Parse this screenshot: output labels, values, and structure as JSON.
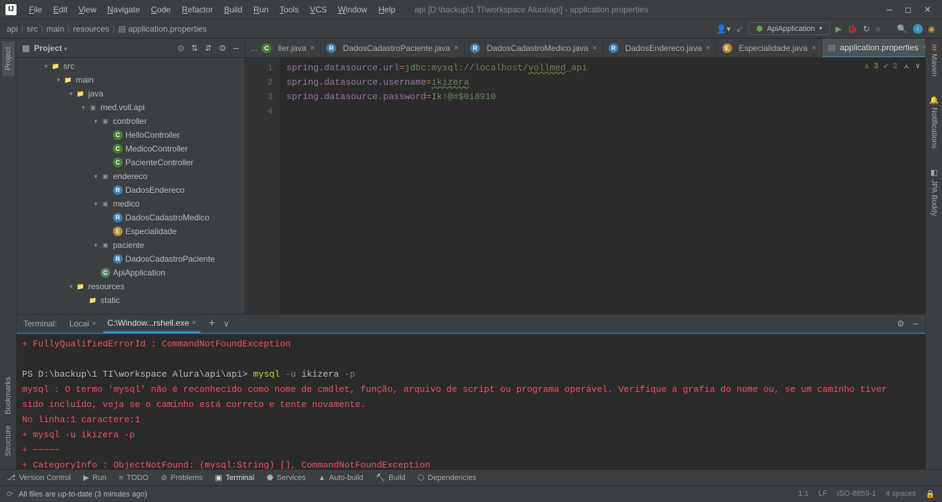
{
  "titlebar": {
    "title": "api [D:\\backup\\1 TI\\workspace Alura\\api] - application.properties",
    "menu": [
      "File",
      "Edit",
      "View",
      "Navigate",
      "Code",
      "Refactor",
      "Build",
      "Run",
      "Tools",
      "VCS",
      "Window",
      "Help"
    ]
  },
  "breadcrumb": [
    "api",
    "src",
    "main",
    "resources",
    "application.properties"
  ],
  "run_config": "ApiApplication",
  "project_panel": {
    "title": "Project",
    "tree": [
      {
        "depth": 2,
        "arrow": "▾",
        "icon": "folder",
        "label": "src"
      },
      {
        "depth": 3,
        "arrow": "▾",
        "icon": "folder-blue",
        "label": "main"
      },
      {
        "depth": 4,
        "arrow": "▾",
        "icon": "folder-blue",
        "label": "java"
      },
      {
        "depth": 5,
        "arrow": "▾",
        "icon": "pkg",
        "label": "med.voll.api"
      },
      {
        "depth": 6,
        "arrow": "▾",
        "icon": "pkg",
        "label": "controller"
      },
      {
        "depth": 7,
        "arrow": "",
        "icon": "C",
        "label": "HelloController"
      },
      {
        "depth": 7,
        "arrow": "",
        "icon": "C",
        "label": "MedicoController"
      },
      {
        "depth": 7,
        "arrow": "",
        "icon": "C",
        "label": "PacienteController"
      },
      {
        "depth": 6,
        "arrow": "▾",
        "icon": "pkg",
        "label": "endereco"
      },
      {
        "depth": 7,
        "arrow": "",
        "icon": "R",
        "label": "DadosEndereco"
      },
      {
        "depth": 6,
        "arrow": "▾",
        "icon": "pkg",
        "label": "medico"
      },
      {
        "depth": 7,
        "arrow": "",
        "icon": "R",
        "label": "DadosCadastroMedico"
      },
      {
        "depth": 7,
        "arrow": "",
        "icon": "E",
        "label": "Especialidade"
      },
      {
        "depth": 6,
        "arrow": "▾",
        "icon": "pkg",
        "label": "paciente"
      },
      {
        "depth": 7,
        "arrow": "",
        "icon": "R",
        "label": "DadosCadastroPaciente"
      },
      {
        "depth": 6,
        "arrow": "",
        "icon": "S",
        "label": "ApiApplication"
      },
      {
        "depth": 4,
        "arrow": "▾",
        "icon": "folder-res",
        "label": "resources"
      },
      {
        "depth": 5,
        "arrow": "",
        "icon": "folder",
        "label": "static"
      }
    ]
  },
  "editor_tabs": [
    {
      "label": "ller.java",
      "icon": "C",
      "active": false,
      "trunc": true
    },
    {
      "label": "DadosCadastroPaciente.java",
      "icon": "R",
      "active": false
    },
    {
      "label": "DadosCadastroMedico.java",
      "icon": "R",
      "active": false
    },
    {
      "label": "DadosEndereco.java",
      "icon": "R",
      "active": false
    },
    {
      "label": "Especialidade.java",
      "icon": "E",
      "active": false
    },
    {
      "label": "application.properties",
      "icon": "props",
      "active": true
    }
  ],
  "editor": {
    "warnings": "3",
    "ok": "2",
    "lines": [
      {
        "n": "1",
        "key": "spring.datasource.url",
        "val": "jdbc:mysql://localhost/",
        "val_u": "vollmed",
        "val2": "_api"
      },
      {
        "n": "2",
        "key": "spring.datasource.username",
        "val": "",
        "val_u": "ikizera",
        "val2": ""
      },
      {
        "n": "3",
        "key": "spring.datasource.password",
        "val": "Ik!@#$0i8910",
        "val_u": "",
        "val2": ""
      },
      {
        "n": "4",
        "key": "",
        "val": "",
        "val_u": "",
        "val2": ""
      }
    ]
  },
  "terminal": {
    "label": "Terminal:",
    "tabs": [
      {
        "label": "Local",
        "active": false
      },
      {
        "label": "C:\\Window...rshell.exe",
        "active": true
      }
    ],
    "lines": [
      {
        "cls": "red",
        "indent": "    ",
        "text": "+ FullyQualifiedErrorId : CommandNotFoundException"
      },
      {
        "cls": "",
        "text": ""
      },
      {
        "cls": "prompt",
        "prefix": "PS D:\\backup\\1 TI\\workspace Alura\\api\\api> ",
        "cmd": "mysql",
        "arg1": " -u ",
        "arg2": "ikizera",
        "arg3": " -p"
      },
      {
        "cls": "red",
        "text": "mysql : O termo 'mysql' não é reconhecido como nome de cmdlet, função, arquivo de script ou programa operável. Verifique a grafia do nome ou, se um caminho tiver"
      },
      {
        "cls": "red",
        "text": "sido incluído, veja se o caminho está correto e tente novamente."
      },
      {
        "cls": "red",
        "text": "No linha:1 caractere:1"
      },
      {
        "cls": "red",
        "text": "+ mysql -u ikizera -p"
      },
      {
        "cls": "red",
        "text": "+ ~~~~~"
      },
      {
        "cls": "red",
        "indent": "    ",
        "text": "+ CategoryInfo          : ObjectNotFound: (mysql:String) [], CommandNotFoundException"
      }
    ]
  },
  "bottom_tabs": [
    {
      "icon": "vcs",
      "label": "Version Control"
    },
    {
      "icon": "run",
      "label": "Run"
    },
    {
      "icon": "todo",
      "label": "TODO"
    },
    {
      "icon": "problems",
      "label": "Problems"
    },
    {
      "icon": "terminal",
      "label": "Terminal",
      "active": true
    },
    {
      "icon": "services",
      "label": "Services"
    },
    {
      "icon": "autobuild",
      "label": "Auto-build"
    },
    {
      "icon": "build",
      "label": "Build"
    },
    {
      "icon": "deps",
      "label": "Dependencies"
    }
  ],
  "left_gutter": [
    "Project",
    "Bookmarks",
    "Structure"
  ],
  "right_gutter": [
    "Maven",
    "Notifications",
    "JPA Buddy"
  ],
  "statusbar": {
    "left": "All files are up-to-date (3 minutes ago)",
    "right": [
      "1:1",
      "LF",
      "ISO-8859-1",
      "4 spaces"
    ]
  }
}
